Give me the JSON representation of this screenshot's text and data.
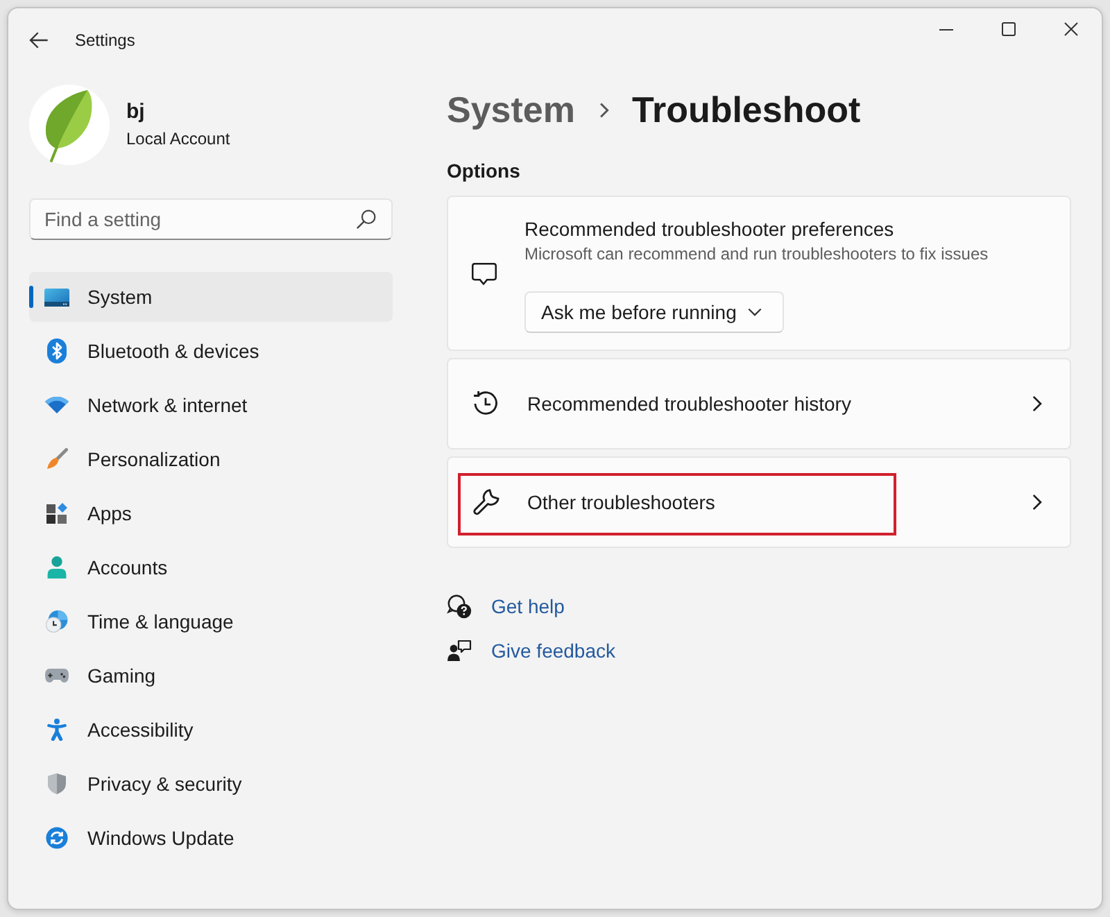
{
  "window": {
    "title": "Settings"
  },
  "profile": {
    "name": "bj",
    "account_type": "Local Account"
  },
  "search": {
    "placeholder": "Find a setting"
  },
  "sidebar": {
    "items": [
      {
        "label": "System",
        "selected": true
      },
      {
        "label": "Bluetooth & devices",
        "selected": false
      },
      {
        "label": "Network & internet",
        "selected": false
      },
      {
        "label": "Personalization",
        "selected": false
      },
      {
        "label": "Apps",
        "selected": false
      },
      {
        "label": "Accounts",
        "selected": false
      },
      {
        "label": "Time & language",
        "selected": false
      },
      {
        "label": "Gaming",
        "selected": false
      },
      {
        "label": "Accessibility",
        "selected": false
      },
      {
        "label": "Privacy & security",
        "selected": false
      },
      {
        "label": "Windows Update",
        "selected": false
      }
    ]
  },
  "breadcrumb": {
    "parent": "System",
    "current": "Troubleshoot"
  },
  "section": {
    "title": "Options"
  },
  "cards": [
    {
      "kind": "dropdown",
      "title": "Recommended troubleshooter preferences",
      "description": "Microsoft can recommend and run troubleshooters to fix issues",
      "dropdown": {
        "value": "Ask me before running"
      },
      "highlighted": false
    },
    {
      "kind": "link",
      "title": "Recommended troubleshooter history",
      "highlighted": false
    },
    {
      "kind": "link",
      "title": "Other troubleshooters",
      "highlighted": true
    }
  ],
  "links": [
    {
      "label": "Get help"
    },
    {
      "label": "Give feedback"
    }
  ]
}
